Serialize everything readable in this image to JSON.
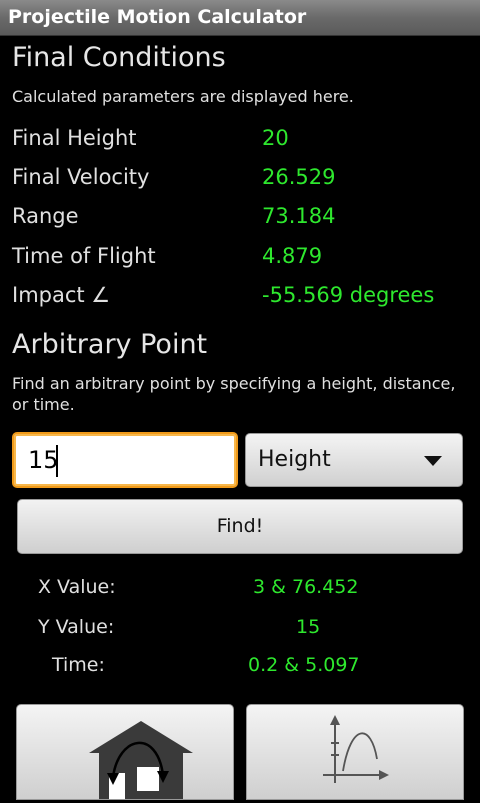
{
  "app": {
    "title": "Projectile Motion Calculator"
  },
  "final_conditions": {
    "title": "Final Conditions",
    "subtitle": "Calculated parameters are displayed here.",
    "rows": [
      {
        "label": "Final Height",
        "value": "20"
      },
      {
        "label": "Final Velocity",
        "value": "26.529"
      },
      {
        "label": "Range",
        "value": "73.184"
      },
      {
        "label": "Time of Flight",
        "value": "4.879"
      },
      {
        "label": "Impact ∠",
        "value": "-55.569 degrees"
      }
    ]
  },
  "arbitrary_point": {
    "title": "Arbitrary Point",
    "subtitle": "Find an arbitrary point by specifying a height, distance, or time.",
    "input_value": "15",
    "selected_option": "Height",
    "find_label": "Find!",
    "results": [
      {
        "label": "X Value:",
        "value": "3 & 76.452"
      },
      {
        "label": "Y Value:",
        "value": "15"
      },
      {
        "label": "Time:",
        "value": "0.2 & 5.097"
      }
    ]
  },
  "bottom_buttons": [
    {
      "icon": "home-trajectory-icon"
    },
    {
      "icon": "graph-icon"
    }
  ],
  "colors": {
    "value_green": "#2ee82e",
    "focus_orange": "#f09a1a"
  }
}
